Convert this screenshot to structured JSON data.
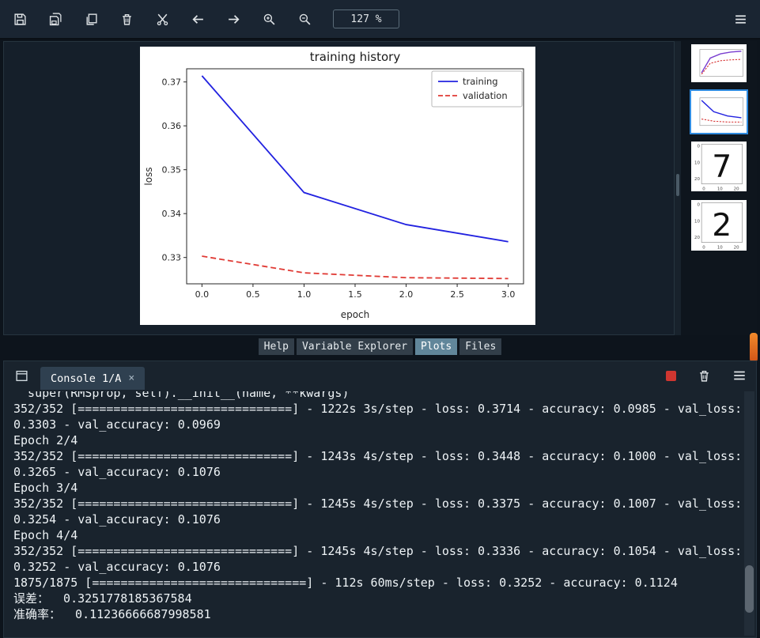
{
  "toolbar": {
    "zoom_level": "127 %",
    "icons": [
      "save",
      "save-all",
      "copy",
      "delete",
      "cut",
      "back",
      "forward",
      "zoom-in",
      "zoom-out",
      "options-menu"
    ]
  },
  "pane_tabs": [
    {
      "label": "Help",
      "selected": false
    },
    {
      "label": "Variable Explorer",
      "selected": false
    },
    {
      "label": "Plots",
      "selected": true
    },
    {
      "label": "Files",
      "selected": false
    }
  ],
  "plots": {
    "thumbnails": [
      {
        "name": "plot-thumbnail-accuracy",
        "kind": "line-up",
        "selected": false
      },
      {
        "name": "plot-thumbnail-loss",
        "kind": "line-down",
        "selected": true
      },
      {
        "name": "plot-thumbnail-digit-7",
        "kind": "digit",
        "digit": "7",
        "selected": false
      },
      {
        "name": "plot-thumbnail-digit-2",
        "kind": "digit",
        "digit": "2",
        "selected": false
      }
    ]
  },
  "chart_data": {
    "type": "line",
    "title": "training history",
    "xlabel": "epoch",
    "ylabel": "loss",
    "xlim": [
      -0.15,
      3.15
    ],
    "ylim": [
      0.324,
      0.373
    ],
    "xticks": {
      "values": [
        0,
        0.5,
        1,
        1.5,
        2,
        2.5,
        3
      ],
      "labels": [
        "0.0",
        "0.5",
        "1.0",
        "1.5",
        "2.0",
        "2.5",
        "3.0"
      ]
    },
    "yticks": {
      "values": [
        0.33,
        0.34,
        0.35,
        0.36,
        0.37
      ],
      "labels": [
        "0.33",
        "0.34",
        "0.35",
        "0.36",
        "0.37"
      ]
    },
    "legend_position": "upper right",
    "grid": false,
    "series": [
      {
        "name": "training",
        "color": "#2222e0",
        "style": "solid",
        "x": [
          0,
          1,
          2,
          3
        ],
        "values": [
          0.3714,
          0.3448,
          0.3375,
          0.3336
        ]
      },
      {
        "name": "validation",
        "color": "#e03a34",
        "style": "dashed",
        "x": [
          0,
          1,
          2,
          3
        ],
        "values": [
          0.3303,
          0.3265,
          0.3254,
          0.3252
        ]
      }
    ]
  },
  "console": {
    "tab_label": "Console 1/A",
    "tab_close": "×",
    "icons": [
      "stop",
      "remove-console",
      "options-menu"
    ],
    "lines": [
      "  super(RMSprop, self).__init__(name, **kwargs)",
      "352/352 [==============================] - 1222s 3s/step - loss: 0.3714 - accuracy: 0.0985 - val_loss:",
      "0.3303 - val_accuracy: 0.0969",
      "Epoch 2/4",
      "352/352 [==============================] - 1243s 4s/step - loss: 0.3448 - accuracy: 0.1000 - val_loss:",
      "0.3265 - val_accuracy: 0.1076",
      "Epoch 3/4",
      "352/352 [==============================] - 1245s 4s/step - loss: 0.3375 - accuracy: 0.1007 - val_loss:",
      "0.3254 - val_accuracy: 0.1076",
      "Epoch 4/4",
      "352/352 [==============================] - 1245s 4s/step - loss: 0.3336 - accuracy: 0.1054 - val_loss:",
      "0.3252 - val_accuracy: 0.1076",
      "1875/1875 [==============================] - 112s 60ms/step - loss: 0.3252 - accuracy: 0.1124",
      "误差：  0.3251778185367584",
      "准确率：  0.11236666687998581"
    ]
  }
}
